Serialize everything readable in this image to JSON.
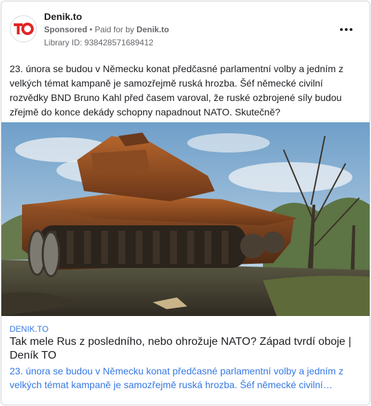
{
  "ad": {
    "page_name": "Denik.to",
    "sponsored_label": "Sponsored",
    "separator": "•",
    "paid_prefix": "Paid for by",
    "payer": "Denik.to",
    "library_id": "Library ID: 938428571689412",
    "more_icon": "more-horizontal-icon",
    "logo_text": "TO",
    "logo_color": "#e02424",
    "body": "23. února se budou v Německu konat předčasné parlamentní volby a jedním z velkých témat kampaně je samozřejmě ruská hrozba. Šéf německé civilní rozvědky BND Bruno Kahl před časem varoval, že ruské ozbrojené síly budou zřejmě do konce dekády schopny napadnout NATO. Skutečně?",
    "media_description_icon": "destroyed-tank-photo"
  },
  "link": {
    "domain": "DENIK.TO",
    "headline": "Tak mele Rus z posledního, nebo ohrožuje NATO? Západ tvrdí oboje | Deník TO",
    "description": "23. února se budou v Německu konat předčasné parlamentní volby a jedním z velkých témat kampaně je samozřejmě ruská hrozba. Šéf německé civilní…",
    "link_color": "#3578e5"
  }
}
